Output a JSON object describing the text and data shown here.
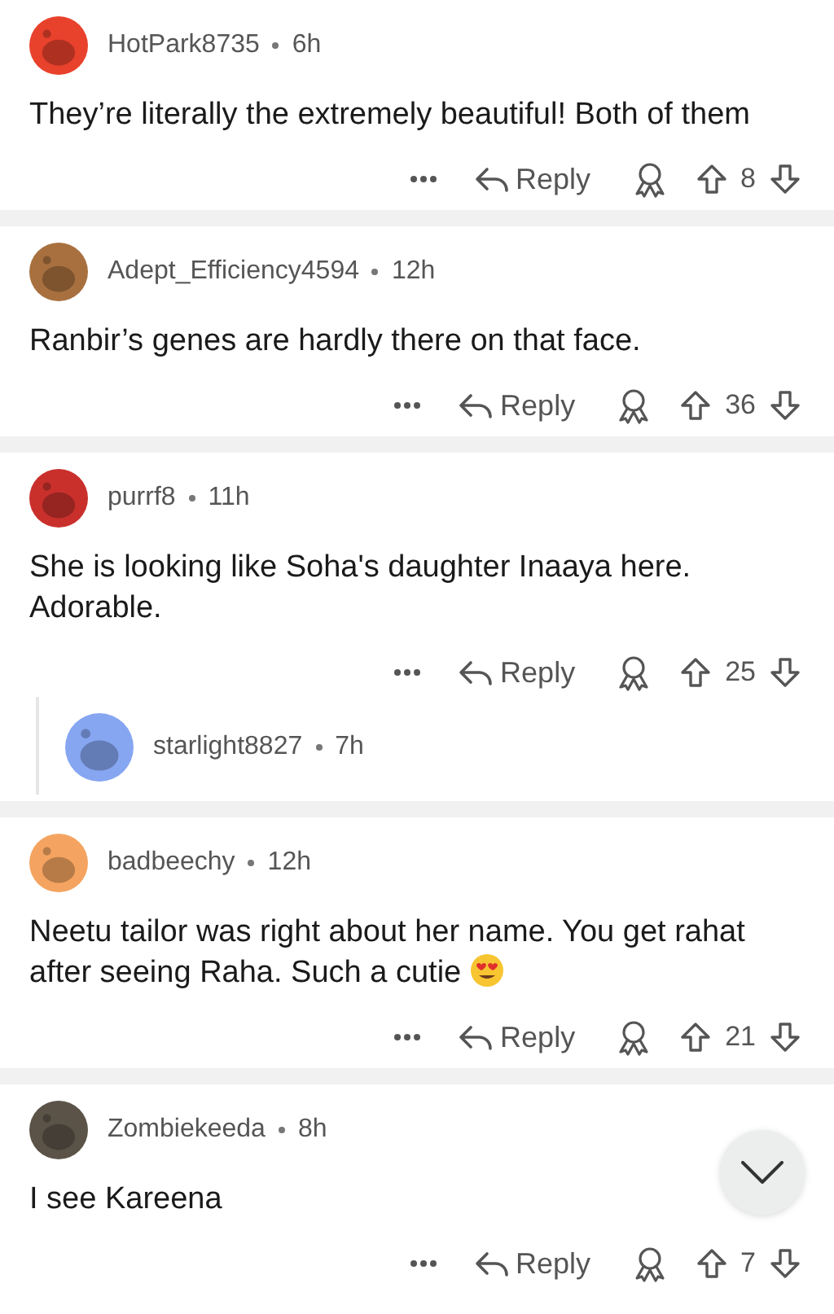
{
  "comments": [
    {
      "user": "HotPark8735",
      "time": "6h",
      "avatar": {
        "color": "#e8412c"
      },
      "body": "They’re literally the extremely beautiful! Both of them",
      "reply": "Reply",
      "score": "8"
    },
    {
      "user": "Adept_Efficiency4594",
      "time": "12h",
      "avatar": {
        "color": "#a8703f"
      },
      "body": "Ranbir’s genes are hardly there on that face.",
      "reply": "Reply",
      "score": "36"
    },
    {
      "user": "purrf8",
      "time": "11h",
      "avatar": {
        "color": "#c9302c"
      },
      "body": "She is looking like Soha's daughter Inaaya here. Adorable.",
      "reply": "Reply",
      "score": "25",
      "replies": [
        {
          "user": "starlight8827",
          "time": "7h",
          "avatar": {
            "color": "#86a6f2"
          }
        }
      ]
    },
    {
      "user": "badbeechy",
      "time": "12h",
      "avatar": {
        "color": "#f4a460"
      },
      "body": "Neetu tailor was right about her name. You get rahat after seeing Raha. Such a cutie",
      "trailing_emoji": {
        "kind": "heart_eyes"
      },
      "reply": "Reply",
      "score": "21"
    },
    {
      "user": "Zombiekeeda",
      "time": "8h",
      "avatar": {
        "color": "#5b5348"
      },
      "body": "I see Kareena",
      "reply": "Reply",
      "score": "7"
    }
  ],
  "scroll_button": {
    "kind": "down"
  }
}
